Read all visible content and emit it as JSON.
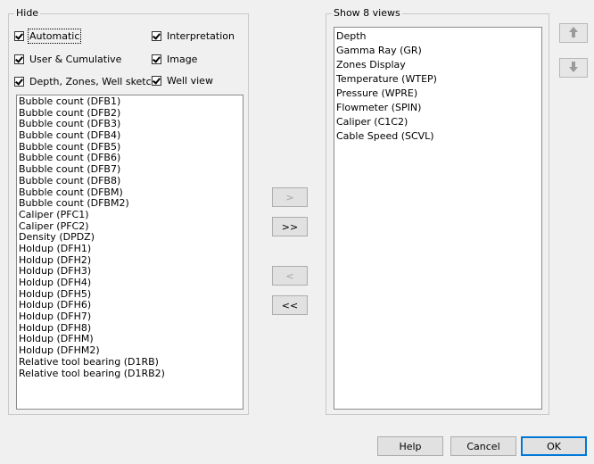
{
  "hide": {
    "title": "Hide",
    "checkboxes": [
      {
        "label": "Automatic",
        "checked": true
      },
      {
        "label": "User & Cumulative",
        "checked": true
      },
      {
        "label": "Depth, Zones, Well sketch",
        "checked": true
      },
      {
        "label": "Interpretation",
        "checked": true
      },
      {
        "label": "Image",
        "checked": true
      },
      {
        "label": "Well view",
        "checked": true
      }
    ],
    "items": [
      "Bubble count (DFB1)",
      "Bubble count (DFB2)",
      "Bubble count (DFB3)",
      "Bubble count (DFB4)",
      "Bubble count (DFB5)",
      "Bubble count (DFB6)",
      "Bubble count (DFB7)",
      "Bubble count (DFB8)",
      "Bubble count (DFBM)",
      "Bubble count (DFBM2)",
      "Caliper (PFC1)",
      "Caliper (PFC2)",
      "Density (DPDZ)",
      "Holdup (DFH1)",
      "Holdup (DFH2)",
      "Holdup (DFH3)",
      "Holdup (DFH4)",
      "Holdup (DFH5)",
      "Holdup (DFH6)",
      "Holdup (DFH7)",
      "Holdup (DFH8)",
      "Holdup (DFHM)",
      "Holdup (DFHM2)",
      "Relative tool bearing (D1RB)",
      "Relative tool bearing (D1RB2)"
    ]
  },
  "show": {
    "title": "Show 8 views",
    "items": [
      "Depth",
      "Gamma Ray (GR)",
      "Zones Display",
      "Temperature (WTEP)",
      "Pressure (WPRE)",
      "Flowmeter (SPIN)",
      "Caliper (C1C2)",
      "Cable Speed (SCVL)"
    ]
  },
  "transfer": {
    "move_right": ">",
    "move_all_right": ">>",
    "move_left": "<",
    "move_all_left": "<<"
  },
  "order": {
    "up_icon": "arrow-up-icon",
    "down_icon": "arrow-down-icon"
  },
  "footer": {
    "help": "Help",
    "cancel": "Cancel",
    "ok": "OK"
  }
}
